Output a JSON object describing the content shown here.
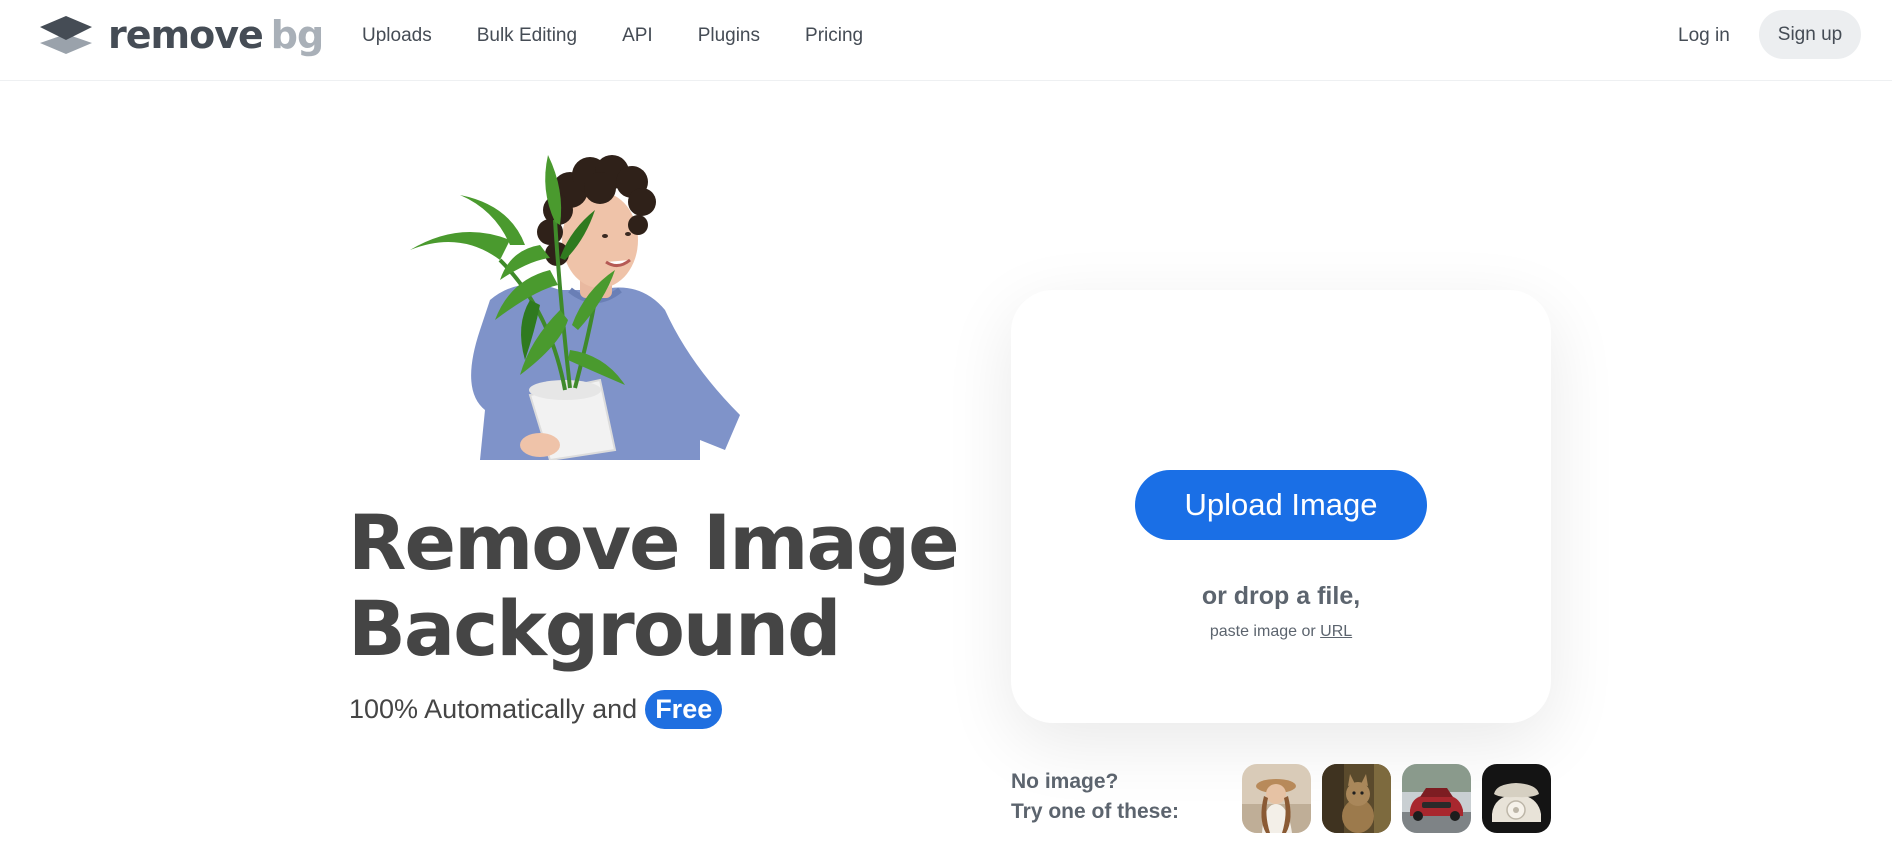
{
  "header": {
    "logo": {
      "primary": "remove",
      "secondary": "bg"
    },
    "nav": [
      {
        "label": "Uploads"
      },
      {
        "label": "Bulk Editing"
      },
      {
        "label": "API"
      },
      {
        "label": "Plugins"
      },
      {
        "label": "Pricing"
      }
    ],
    "login_label": "Log in",
    "signup_label": "Sign up"
  },
  "hero": {
    "title_line1": "Remove Image",
    "title_line2": "Background",
    "subtitle": "100% Automatically and",
    "badge": "Free"
  },
  "upload": {
    "button_label": "Upload Image",
    "drop_text": "or drop a file,",
    "paste_text": "paste image or",
    "url_label": "URL"
  },
  "samples": {
    "label_line1": "No image?",
    "label_line2": "Try one of these:",
    "items": [
      {
        "icon": "woman-photo-icon"
      },
      {
        "icon": "cat-photo-icon"
      },
      {
        "icon": "car-photo-icon"
      },
      {
        "icon": "telephone-photo-icon"
      }
    ]
  },
  "colors": {
    "accent": "#1a6fe6",
    "text": "#454545",
    "muted": "#5c646e"
  }
}
